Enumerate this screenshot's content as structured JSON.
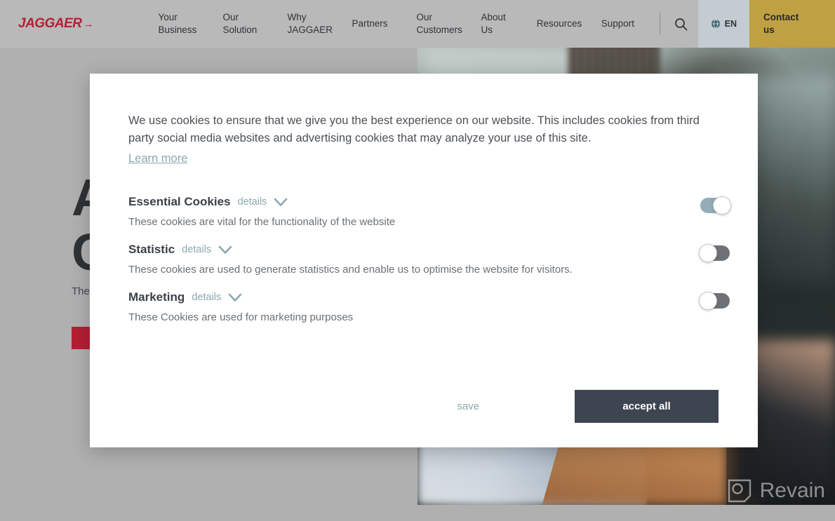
{
  "site": {
    "brand": "JAGGAER",
    "brand_arrow": "→"
  },
  "nav": {
    "items": [
      {
        "label": "Your\nBusiness",
        "name": "nav-your-business"
      },
      {
        "label": "Our\nSolution",
        "name": "nav-our-solution"
      },
      {
        "label": "Why\nJAGGAER",
        "name": "nav-why-jaggaer"
      },
      {
        "label": "Partners",
        "name": "nav-partners"
      },
      {
        "label": "Our\nCustomers",
        "name": "nav-our-customers"
      },
      {
        "label": "About\nUs",
        "name": "nav-about-us"
      },
      {
        "label": "Resources",
        "name": "nav-resources"
      },
      {
        "label": "Support",
        "name": "nav-support"
      }
    ],
    "search_icon": "search-icon",
    "language": {
      "icon": "globe-icon",
      "label": "EN"
    },
    "contact": {
      "label": "Contact\nus",
      "color": "#bfa043"
    }
  },
  "hero": {
    "headline": "A\nC",
    "subtext": "The",
    "cta_label": ""
  },
  "cookie_modal": {
    "intro": "We use cookies to ensure that we give you the best experience on our website. This includes cookies from third party social media websites and advertising cookies that may analyze your use of this site.",
    "learn_more": "Learn more",
    "details_label": "details",
    "categories": [
      {
        "title": "Essential Cookies",
        "details": "details",
        "description": "These cookies are vital for the functionality of the website",
        "enabled": true
      },
      {
        "title": "Statistic",
        "details": "details",
        "description": "These cookies are used to generate statistics and enable us to optimise the website for visitors.",
        "enabled": false
      },
      {
        "title": "Marketing",
        "details": "details",
        "description": "These Cookies are used for marketing purposes",
        "enabled": false
      }
    ],
    "save_label": "save",
    "accept_all_label": "accept all",
    "accent_link_color": "#8aa8ae",
    "accept_button_color": "#3d4551"
  },
  "watermark": {
    "text": "Revain",
    "icon": "revain-logo-icon"
  }
}
